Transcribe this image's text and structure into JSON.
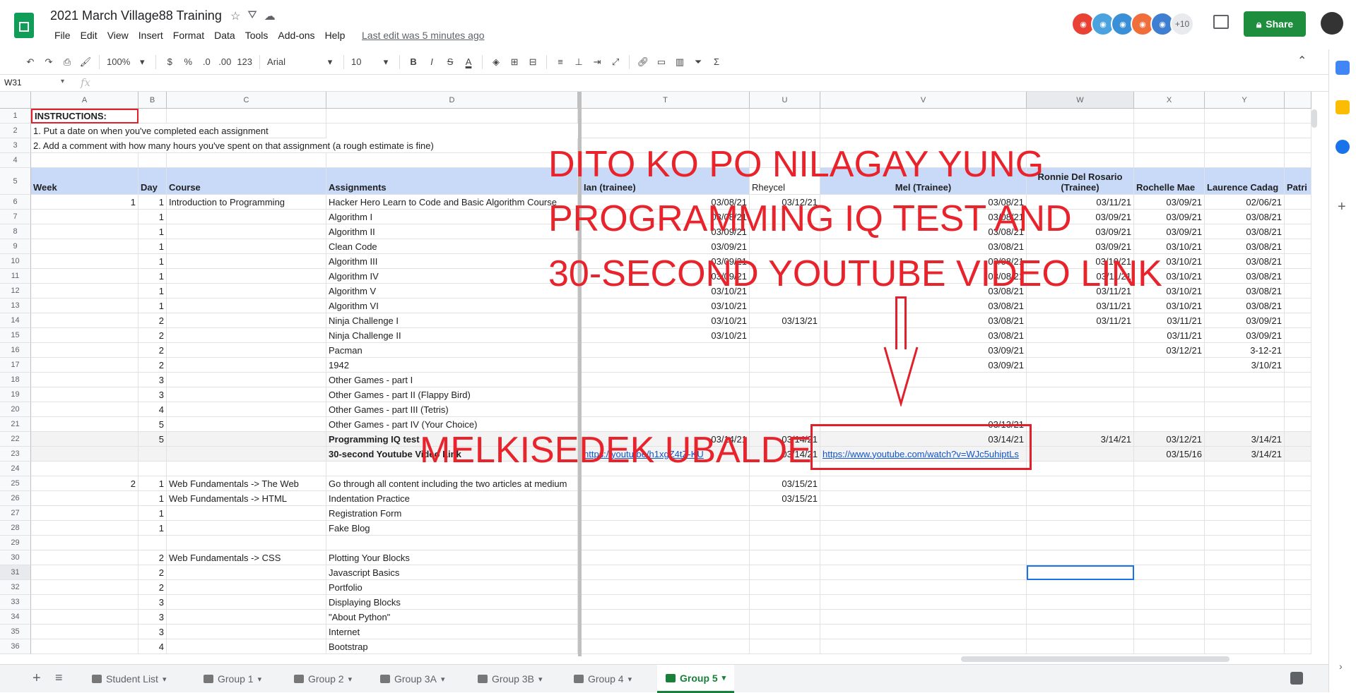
{
  "doc": {
    "title": "2021 March Village88 Training",
    "last_edit": "Last edit was 5 minutes ago"
  },
  "menu": [
    "File",
    "Edit",
    "View",
    "Insert",
    "Format",
    "Data",
    "Tools",
    "Add-ons",
    "Help"
  ],
  "avatars_more": "+10",
  "share_label": "Share",
  "toolbar": {
    "zoom": "100%",
    "currency": "$",
    "percent": "%",
    "dec_less": ".0",
    "dec_more": ".00",
    "number_format": "123",
    "font": "Arial",
    "font_size": "10",
    "bold": "B",
    "italic": "I",
    "strike": "S",
    "text_color": "A"
  },
  "formula": {
    "cell_ref": "W31",
    "fx": "fx"
  },
  "columns": [
    "A",
    "B",
    "C",
    "D",
    "T",
    "U",
    "V",
    "W",
    "X",
    "Y"
  ],
  "rows": [
    "1",
    "2",
    "3",
    "4",
    "5",
    "6",
    "7",
    "8",
    "9",
    "10",
    "11",
    "12",
    "13",
    "14",
    "15",
    "16",
    "17",
    "18",
    "19",
    "20",
    "21",
    "22",
    "23",
    "24",
    "25",
    "26",
    "27",
    "28",
    "29",
    "30",
    "31",
    "32",
    "33",
    "34",
    "35",
    "36"
  ],
  "instructions": {
    "title": "INSTRUCTIONS:",
    "line1": "1. Put a date on when you've completed each assignment",
    "line2": "2. Add a comment with how many hours you've spent on that assignment (a rough estimate is fine)"
  },
  "headers": {
    "week": "Week",
    "day": "Day",
    "course": "Course",
    "assignments": "Assignments",
    "t": "Ian (trainee)",
    "u": "Rheycel",
    "v": "Mel (Trainee)",
    "w": "Ronnie Del Rosario (Trainee)",
    "x": "Rochelle Mae",
    "y": "Laurence Cadag",
    "z": "Patri"
  },
  "table_rows": [
    {
      "a": "1",
      "b": "1",
      "c": "Introduction to Programming",
      "d": "Hacker Hero Learn to Code and Basic Algorithm Course",
      "t": "03/08/21",
      "u": "03/12/21",
      "v": "03/08/21",
      "w": "03/11/21",
      "x": "03/09/21",
      "y": "02/06/21"
    },
    {
      "a": "",
      "b": "1",
      "c": "",
      "d": "Algorithm I",
      "t": "03/08/21",
      "u": "",
      "v": "03/08/21",
      "w": "03/09/21",
      "x": "03/09/21",
      "y": "03/08/21"
    },
    {
      "a": "",
      "b": "1",
      "c": "",
      "d": "Algorithm II",
      "t": "03/09/21",
      "u": "",
      "v": "03/08/21",
      "w": "03/09/21",
      "x": "03/09/21",
      "y": "03/08/21"
    },
    {
      "a": "",
      "b": "1",
      "c": "",
      "d": "Clean Code",
      "t": "03/09/21",
      "u": "",
      "v": "03/08/21",
      "w": "03/09/21",
      "x": "03/10/21",
      "y": "03/08/21"
    },
    {
      "a": "",
      "b": "1",
      "c": "",
      "d": "Algorithm III",
      "t": "03/09/21",
      "u": "",
      "v": "03/08/21",
      "w": "03/10/21",
      "x": "03/10/21",
      "y": "03/08/21"
    },
    {
      "a": "",
      "b": "1",
      "c": "",
      "d": "Algorithm IV",
      "t": "03/09/21",
      "u": "",
      "v": "03/08/21",
      "w": "03/11/21",
      "x": "03/10/21",
      "y": "03/08/21"
    },
    {
      "a": "",
      "b": "1",
      "c": "",
      "d": "Algorithm V",
      "t": "03/10/21",
      "u": "",
      "v": "03/08/21",
      "w": "03/11/21",
      "x": "03/10/21",
      "y": "03/08/21"
    },
    {
      "a": "",
      "b": "1",
      "c": "",
      "d": "Algorithm VI",
      "t": "03/10/21",
      "u": "",
      "v": "03/08/21",
      "w": "03/11/21",
      "x": "03/10/21",
      "y": "03/08/21"
    },
    {
      "a": "",
      "b": "2",
      "c": "",
      "d": "Ninja Challenge I",
      "t": "03/10/21",
      "u": "03/13/21",
      "v": "03/08/21",
      "w": "03/11/21",
      "x": "03/11/21",
      "y": "03/09/21"
    },
    {
      "a": "",
      "b": "2",
      "c": "",
      "d": "Ninja Challenge II",
      "t": "03/10/21",
      "u": "",
      "v": "03/08/21",
      "w": "",
      "x": "03/11/21",
      "y": "03/09/21"
    },
    {
      "a": "",
      "b": "2",
      "c": "",
      "d": "Pacman",
      "t": "",
      "u": "",
      "v": "03/09/21",
      "w": "",
      "x": "03/12/21",
      "y": "3-12-21"
    },
    {
      "a": "",
      "b": "2",
      "c": "",
      "d": "1942",
      "t": "",
      "u": "",
      "v": "03/09/21",
      "w": "",
      "x": "",
      "y": "3/10/21"
    },
    {
      "a": "",
      "b": "3",
      "c": "",
      "d": "Other Games - part I",
      "t": "",
      "u": "",
      "v": "",
      "w": "",
      "x": "",
      "y": ""
    },
    {
      "a": "",
      "b": "3",
      "c": "",
      "d": "Other Games - part II (Flappy Bird)",
      "t": "",
      "u": "",
      "v": "",
      "w": "",
      "x": "",
      "y": ""
    },
    {
      "a": "",
      "b": "4",
      "c": "",
      "d": "Other Games - part III (Tetris)",
      "t": "",
      "u": "",
      "v": "",
      "w": "",
      "x": "",
      "y": ""
    },
    {
      "a": "",
      "b": "5",
      "c": "",
      "d": "Other Games - part IV (Your Choice)",
      "t": "",
      "u": "",
      "v": "03/13/21",
      "w": "",
      "x": "",
      "y": ""
    },
    {
      "a": "",
      "b": "5",
      "c": "",
      "d": "Programming IQ test",
      "t": "03/14/21",
      "u": "03/14/21",
      "v": "03/14/21",
      "w": "3/14/21",
      "x": "03/12/21",
      "y": "3/14/21",
      "bold": true
    },
    {
      "a": "",
      "b": "",
      "c": "",
      "d": "30-second Youtube Video Link",
      "t": "https://youtu.be/h1xgZ4tZ-KU",
      "u": "03/14/21",
      "v": "https://www.youtube.com/watch?v=WJc5uhiptLs",
      "w": "",
      "x": "03/15/16",
      "y": "3/14/21",
      "bold": true
    },
    {
      "a": "",
      "b": "",
      "c": "",
      "d": "",
      "t": "",
      "u": "",
      "v": "",
      "w": "",
      "x": "",
      "y": ""
    },
    {
      "a": "2",
      "b": "1",
      "c": "Web Fundamentals -> The Web",
      "d": "Go through all content including the two articles at medium",
      "t": "",
      "u": "03/15/21",
      "v": "",
      "w": "",
      "x": "",
      "y": ""
    },
    {
      "a": "",
      "b": "1",
      "c": "Web Fundamentals -> HTML",
      "d": "Indentation Practice",
      "t": "",
      "u": "03/15/21",
      "v": "",
      "w": "",
      "x": "",
      "y": ""
    },
    {
      "a": "",
      "b": "1",
      "c": "",
      "d": "Registration Form",
      "t": "",
      "u": "",
      "v": "",
      "w": "",
      "x": "",
      "y": ""
    },
    {
      "a": "",
      "b": "1",
      "c": "",
      "d": "Fake Blog",
      "t": "",
      "u": "",
      "v": "",
      "w": "",
      "x": "",
      "y": ""
    },
    {
      "a": "",
      "b": "",
      "c": "",
      "d": "",
      "t": "",
      "u": "",
      "v": "",
      "w": "",
      "x": "",
      "y": ""
    },
    {
      "a": "",
      "b": "2",
      "c": "Web Fundamentals -> CSS",
      "d": "Plotting Your Blocks",
      "t": "",
      "u": "",
      "v": "",
      "w": "",
      "x": "",
      "y": ""
    },
    {
      "a": "",
      "b": "2",
      "c": "",
      "d": "Javascript Basics",
      "t": "",
      "u": "",
      "v": "",
      "w": "",
      "x": "",
      "y": ""
    },
    {
      "a": "",
      "b": "2",
      "c": "",
      "d": "Portfolio",
      "t": "",
      "u": "",
      "v": "",
      "w": "",
      "x": "",
      "y": ""
    },
    {
      "a": "",
      "b": "3",
      "c": "",
      "d": "Displaying Blocks",
      "t": "",
      "u": "",
      "v": "",
      "w": "",
      "x": "",
      "y": ""
    },
    {
      "a": "",
      "b": "3",
      "c": "",
      "d": "\"About Python\"",
      "t": "",
      "u": "",
      "v": "",
      "w": "",
      "x": "",
      "y": ""
    },
    {
      "a": "",
      "b": "3",
      "c": "",
      "d": "Internet",
      "t": "",
      "u": "",
      "v": "",
      "w": "",
      "x": "",
      "y": ""
    },
    {
      "a": "",
      "b": "4",
      "c": "",
      "d": "Bootstrap",
      "t": "",
      "u": "",
      "v": "",
      "w": "",
      "x": "",
      "y": ""
    }
  ],
  "annotation": {
    "line1": "DITO KO PO NILAGAY YUNG",
    "line2": "PROGRAMMING IQ TEST AND",
    "line3": "30-SECOND YOUTUBE VIDEO LINK",
    "name": "MELKISEDEK UBALDE"
  },
  "sheets": [
    "Student List",
    "Group 1",
    "Group 2",
    "Group 3A",
    "Group 3B",
    "Group 4",
    "Group 5"
  ],
  "active_sheet": "Group 5",
  "colors": {
    "accent": "#1e8e3e",
    "annotation": "#e8232b",
    "header_fill": "#c9daf8",
    "link": "#1155cc"
  }
}
